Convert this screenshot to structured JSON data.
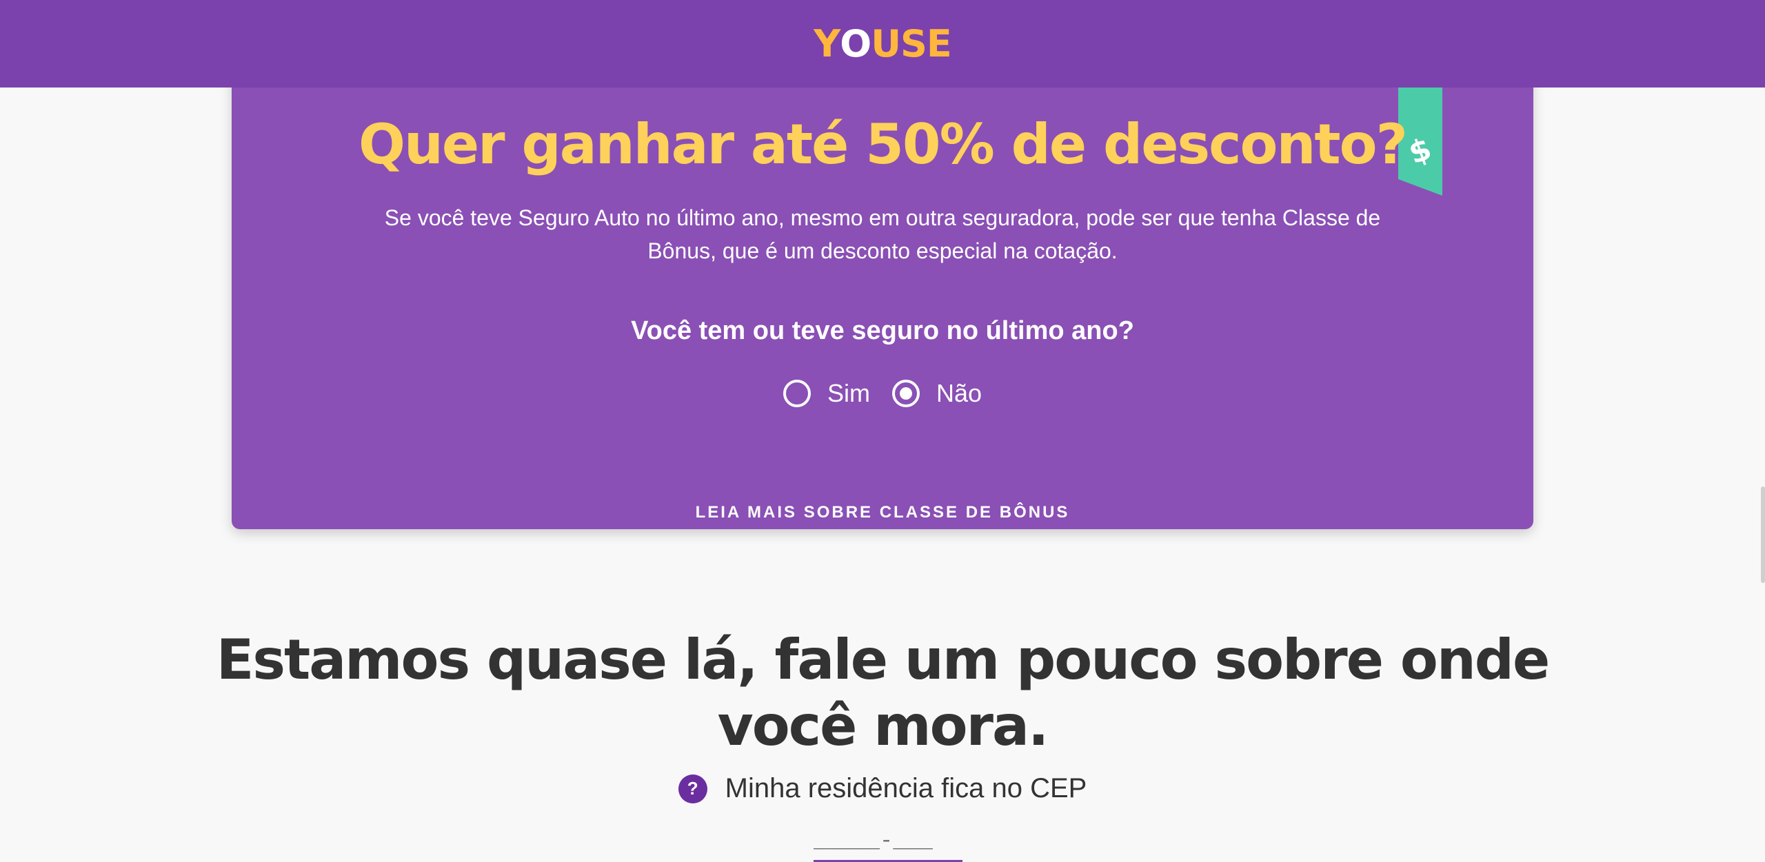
{
  "header": {
    "logo_text": "YOUSE",
    "logo_parts": {
      "first": "Y",
      "second": "O",
      "rest": "USE"
    }
  },
  "bonus_card": {
    "headline": "Quer ganhar até 50% de desconto?",
    "intro": "Se você teve Seguro Auto no último ano, mesmo em outra seguradora, pode ser que tenha Classe de Bônus, que é um desconto especial na cotação.",
    "question": "Você tem ou teve seguro no último ano?",
    "options": [
      {
        "label": "Sim",
        "selected": false
      },
      {
        "label": "Não",
        "selected": true
      }
    ],
    "read_more_link": "LEIA MAIS SOBRE CLASSE DE BÔNUS",
    "tag_icon": "dollar-tag-icon"
  },
  "address_section": {
    "title": "Estamos quase lá, fale um pouco sobre onde você mora.",
    "help_icon": "?",
    "cep_label": "Minha residência fica no CEP",
    "cep_placeholder": "_____-___"
  },
  "colors": {
    "header_bg": "#7b41ac",
    "card_bg": "#8a50b5",
    "headline": "#fdd15a",
    "logo": "#ffb63d",
    "tag": "#4ccba8",
    "page_bg": "#f8f8f8",
    "text_dark": "#333333"
  }
}
